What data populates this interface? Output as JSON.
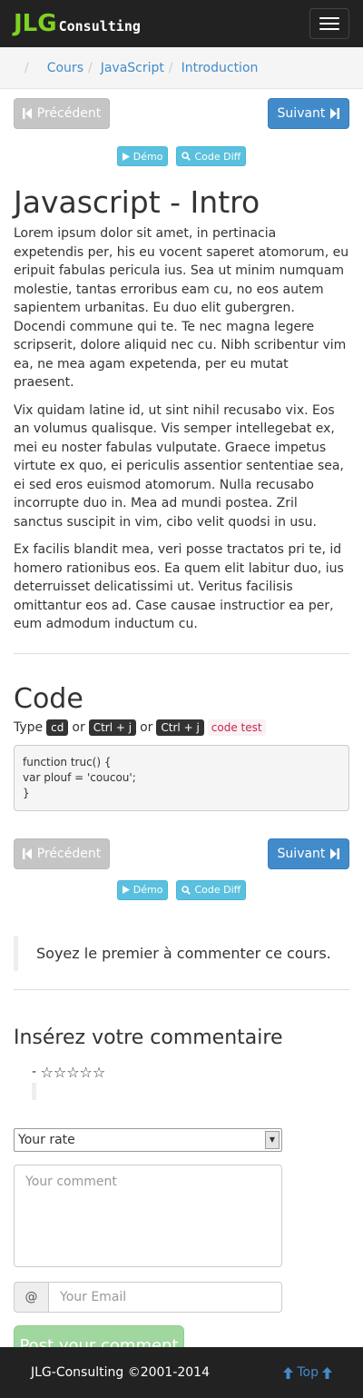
{
  "brand": {
    "main": "JLG",
    "sub": "Consulting"
  },
  "breadcrumb": {
    "items": [
      "Cours",
      "JavaScript",
      "Introduction"
    ]
  },
  "pager_top": {
    "prev": "Précédent",
    "next": "Suivant",
    "demo": "Démo",
    "diff": "Code Diff"
  },
  "pager_bottom": {
    "prev": "Précédent",
    "next": "Suivant",
    "demo": "Démo",
    "diff": "Code Diff"
  },
  "article": {
    "title": "Javascript - Intro",
    "paragraphs": [
      "Lorem ipsum dolor sit amet, in pertinacia expetendis per, his eu vocent saperet atomorum, eu eripuit fabulas pericula ius. Sea ut minim numquam molestie, tantas erroribus eam cu, no eos autem sapientem urbanitas. Eu duo elit gubergren. Docendi commune qui te. Te nec magna legere scripserit, dolore aliquid nec cu. Nibh scribentur vim ea, ne mea agam expetenda, per eu mutat praesent.",
      "Vix quidam latine id, ut sint nihil recusabo vix. Eos an volumus qualisque. Vis semper intellegebat ex, mei eu noster fabulas vulputate. Graece impetus virtute ex quo, ei periculis assentior sententiae sea, ei sed eros euismod atomorum. Nulla recusabo incorrupte duo in. Mea ad mundi postea. Zril sanctus suscipit in vim, cibo velit quodsi in usu.",
      "Ex facilis blandit mea, veri posse tractatos pri te, id homero rationibus eos. Ea quem elit labitur duo, ius deterruisset delicatissimi ut. Veritus facilisis omittantur eos ad. Case causae instructior ea per, eum admodum inductum cu."
    ]
  },
  "code_section": {
    "title": "Code",
    "type_label": "Type",
    "kbd1": "cd",
    "or1": "or",
    "kbd2": "Ctrl + j",
    "or2": "or",
    "kbd3": "Ctrl + j",
    "code_test": "code test",
    "code_block": "function truc() {\nvar plouf = 'coucou';\n}"
  },
  "comments": {
    "first_message": "Soyez le premier à commenter ce cours.",
    "form_title": "Insérez votre commentaire",
    "rating_prefix": "- ",
    "rating_stars": "☆☆☆☆☆",
    "rate_select": "Your rate",
    "comment_placeholder": "Your comment",
    "email_addon": "@",
    "email_placeholder": "Your Email",
    "post_label": "Post your comment"
  },
  "footer": {
    "copyright": "JLG-Consulting ©2001-2014",
    "top_label": "Top"
  },
  "colors": {
    "brand_green": "#7ed321",
    "primary": "#428bca",
    "info": "#5bc0de",
    "success_light": "#9fd79f",
    "dark": "#222222"
  }
}
